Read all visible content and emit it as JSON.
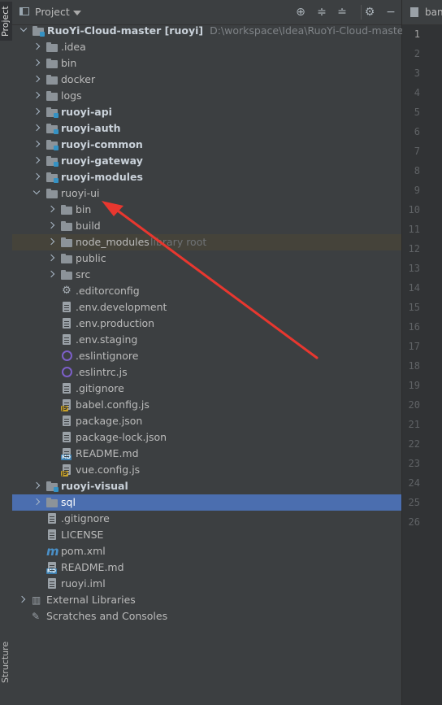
{
  "left_strip": {
    "project_tab": "Project",
    "structure_tab": "Structure"
  },
  "header": {
    "title": "Project",
    "icons": [
      "locate-icon",
      "expand-all-icon",
      "collapse-all-icon",
      "settings-icon",
      "hide-icon"
    ]
  },
  "tree": {
    "root": {
      "name": "RuoYi-Cloud-master [ruoyi]",
      "path": "D:\\workspace\\Idea\\RuoYi-Cloud-master"
    },
    "items": [
      {
        "label": ".idea",
        "icon": "folder"
      },
      {
        "label": "bin",
        "icon": "folder"
      },
      {
        "label": "docker",
        "icon": "folder"
      },
      {
        "label": "logs",
        "icon": "folder"
      },
      {
        "label": "ruoyi-api",
        "icon": "module-folder"
      },
      {
        "label": "ruoyi-auth",
        "icon": "module-folder"
      },
      {
        "label": "ruoyi-common",
        "icon": "module-folder"
      },
      {
        "label": "ruoyi-gateway",
        "icon": "module-folder"
      },
      {
        "label": "ruoyi-modules",
        "icon": "module-folder"
      },
      {
        "label": "ruoyi-ui",
        "icon": "folder",
        "expanded": true
      },
      {
        "label": "bin",
        "icon": "folder"
      },
      {
        "label": "build",
        "icon": "folder"
      },
      {
        "label": "node_modules",
        "icon": "folder",
        "note": "library root"
      },
      {
        "label": "public",
        "icon": "folder"
      },
      {
        "label": "src",
        "icon": "folder"
      },
      {
        "label": ".editorconfig",
        "icon": "gear"
      },
      {
        "label": ".env.development",
        "icon": "file"
      },
      {
        "label": ".env.production",
        "icon": "file"
      },
      {
        "label": ".env.staging",
        "icon": "file"
      },
      {
        "label": ".eslintignore",
        "icon": "eslint"
      },
      {
        "label": ".eslintrc.js",
        "icon": "eslint"
      },
      {
        "label": ".gitignore",
        "icon": "file"
      },
      {
        "label": "babel.config.js",
        "icon": "js"
      },
      {
        "label": "package.json",
        "icon": "json"
      },
      {
        "label": "package-lock.json",
        "icon": "json"
      },
      {
        "label": "README.md",
        "icon": "md"
      },
      {
        "label": "vue.config.js",
        "icon": "js"
      },
      {
        "label": "ruoyi-visual",
        "icon": "module-folder"
      },
      {
        "label": "sql",
        "icon": "folder",
        "selected": true
      },
      {
        "label": ".gitignore",
        "icon": "file"
      },
      {
        "label": "LICENSE",
        "icon": "file"
      },
      {
        "label": "pom.xml",
        "icon": "maven"
      },
      {
        "label": "README.md",
        "icon": "md"
      },
      {
        "label": "ruoyi.iml",
        "icon": "file"
      },
      {
        "label": "External Libraries",
        "icon": "libraries"
      },
      {
        "label": "Scratches and Consoles",
        "icon": "scratches"
      }
    ]
  },
  "editor": {
    "tab_label": "ban",
    "line_numbers": [
      "1",
      "2",
      "3",
      "4",
      "5",
      "6",
      "7",
      "8",
      "9",
      "10",
      "11",
      "12",
      "13",
      "14",
      "15",
      "16",
      "17",
      "18",
      "19",
      "20",
      "21",
      "22",
      "23",
      "24",
      "25",
      "26"
    ]
  },
  "annotation": {
    "color": "#e8372f"
  }
}
